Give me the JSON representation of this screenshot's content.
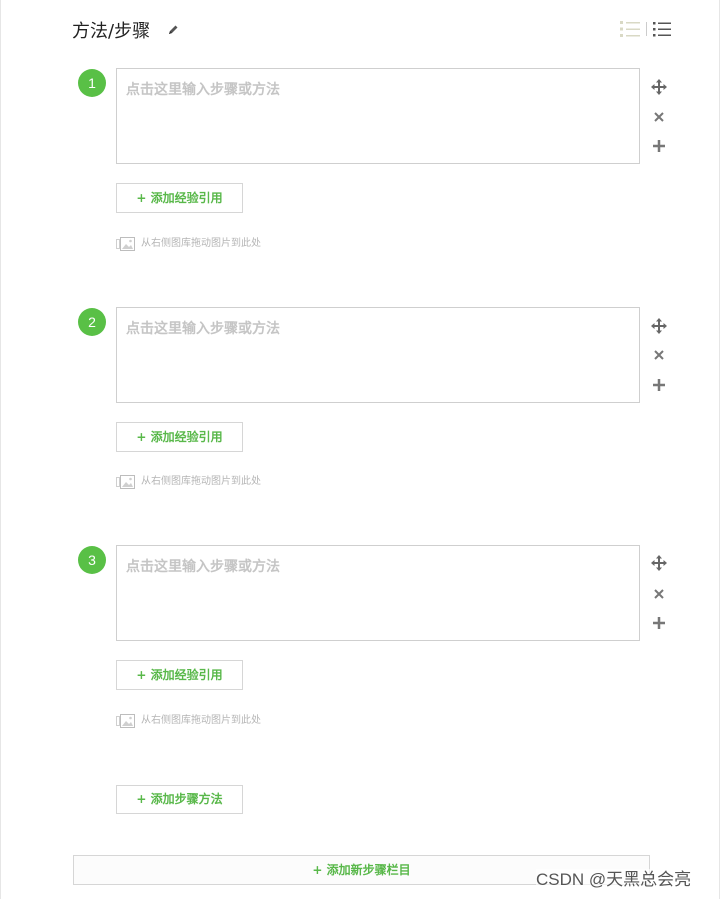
{
  "header": {
    "title": "方法/步骤"
  },
  "steps": [
    {
      "number": "1",
      "placeholder": "点击这里输入步骤或方法",
      "ref_label": "+ 添加经验引用",
      "drop_hint": "从右侧图库拖动图片到此处"
    },
    {
      "number": "2",
      "placeholder": "点击这里输入步骤或方法",
      "ref_label": "+ 添加经验引用",
      "drop_hint": "从右侧图库拖动图片到此处"
    },
    {
      "number": "3",
      "placeholder": "点击这里输入步骤或方法",
      "ref_label": "+ 添加经验引用",
      "drop_hint": "从右侧图库拖动图片到此处"
    }
  ],
  "footer": {
    "add_step_label": "+ 添加步骤方法",
    "add_section_label": "+ 添加新步骤栏目"
  },
  "watermark": "CSDN @天黑总会亮",
  "colors": {
    "accent": "#59c046",
    "accent_text": "#59b84a",
    "border": "#cfcfcf",
    "placeholder": "#c5c5c5"
  },
  "icons": {
    "edit": "pencil-icon",
    "ordered_view": "ordered-list-icon",
    "list_view": "list-icon",
    "move": "move-icon",
    "delete": "close-icon",
    "add": "plus-icon",
    "image": "image-icon"
  }
}
